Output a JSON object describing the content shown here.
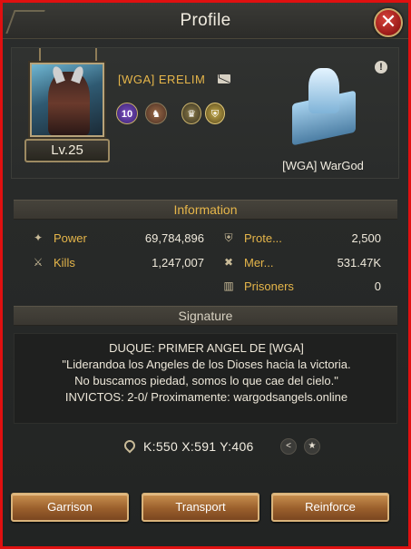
{
  "window": {
    "title": "Profile"
  },
  "player": {
    "name": "[WGA] ERELIM",
    "level": "Lv.25",
    "vip_level": "10"
  },
  "alliance": {
    "tag": "[WGA] WarGod"
  },
  "sections": {
    "information": "Information",
    "signature": "Signature"
  },
  "stats": {
    "power": {
      "label": "Power",
      "value": "69,784,896"
    },
    "kills": {
      "label": "Kills",
      "value": "1,247,007"
    },
    "protection": {
      "label": "Prote...",
      "value": "2,500"
    },
    "merits": {
      "label": "Mer...",
      "value": "531.47K"
    },
    "prisoners": {
      "label": "Prisoners",
      "value": "0"
    }
  },
  "signature": {
    "lines": [
      "DUQUE: PRIMER ANGEL  DE [WGA]",
      "\"Liderandoa los Angeles de los Dioses hacia la victoria.",
      "No buscamos piedad, somos lo que cae del cielo.\"",
      "INVICTOS: 2-0/ Proximamente: wargodsangels.online"
    ]
  },
  "location": {
    "coords": "K:550 X:591 Y:406"
  },
  "actions": {
    "garrison": "Garrison",
    "transport": "Transport",
    "reinforce": "Reinforce"
  },
  "icons": {
    "close": "close-icon",
    "mail": "mail-icon",
    "alert": "alert-icon",
    "power": "power-icon",
    "kills": "kills-icon",
    "protection": "shield-icon",
    "merits": "merit-icon",
    "prisoners": "prison-icon",
    "location": "location-pin-icon",
    "share": "share-icon",
    "favorite": "star-icon"
  },
  "colors": {
    "accent_gold": "#e6b64a",
    "button_orange": "#b0733c",
    "frame_red": "#e01010"
  }
}
